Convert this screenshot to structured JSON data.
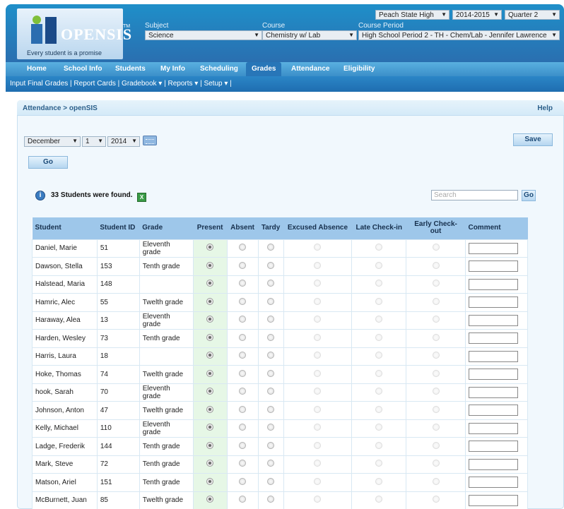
{
  "header": {
    "tagline": "Every student is a promise",
    "logo_text": "OPENSIS",
    "logo_tm": "TM",
    "school": "Peach State High",
    "year": "2014-2015",
    "quarter": "Quarter 2",
    "subject_label": "Subject",
    "subject_value": "Science",
    "course_label": "Course",
    "course_value": "Chemistry w/ Lab",
    "period_label": "Course Period",
    "period_value": "High School Period 2 - TH - Chem/Lab - Jennifer Lawrence"
  },
  "nav": {
    "items": [
      "Home",
      "School Info",
      "Students",
      "My Info",
      "Scheduling",
      "Grades",
      "Attendance",
      "Eligibility"
    ],
    "active": "Grades"
  },
  "subnav": {
    "text": "Input Final Grades  |  Report Cards  |  Gradebook ▾  |   Reports ▾  |  Setup ▾  |"
  },
  "panel": {
    "breadcrumb": "Attendance > openSIS",
    "help": "Help",
    "month": "December",
    "day": "1",
    "year": "2014",
    "go_label": "Go",
    "save_label": "Save",
    "found_text": "33 Students were found.",
    "search_placeholder": "Search",
    "search_go": "Go"
  },
  "table": {
    "headers": [
      "Student",
      "Student ID",
      "Grade",
      "Present",
      "Absent",
      "Tardy",
      "Excused Absence",
      "Late Check-in",
      "Early Check-out",
      "Comment"
    ],
    "rows": [
      {
        "name": "Daniel, Marie",
        "id": "51",
        "grade": "Eleventh grade"
      },
      {
        "name": "Dawson, Stella",
        "id": "153",
        "grade": "Tenth grade"
      },
      {
        "name": "Halstead, Maria",
        "id": "148",
        "grade": ""
      },
      {
        "name": "Hamric, Alec",
        "id": "55",
        "grade": "Twelth grade"
      },
      {
        "name": "Haraway, Alea",
        "id": "13",
        "grade": "Eleventh grade"
      },
      {
        "name": "Harden, Wesley",
        "id": "73",
        "grade": "Tenth grade"
      },
      {
        "name": "Harris, Laura",
        "id": "18",
        "grade": ""
      },
      {
        "name": "Hoke, Thomas",
        "id": "74",
        "grade": "Twelth grade"
      },
      {
        "name": "hook, Sarah",
        "id": "70",
        "grade": "Eleventh grade"
      },
      {
        "name": "Johnson, Anton",
        "id": "47",
        "grade": "Twelth grade"
      },
      {
        "name": "Kelly, Michael",
        "id": "110",
        "grade": "Eleventh grade"
      },
      {
        "name": "Ladge, Frederik",
        "id": "144",
        "grade": "Tenth grade"
      },
      {
        "name": "Mark, Steve",
        "id": "72",
        "grade": "Tenth grade"
      },
      {
        "name": "Matson, Ariel",
        "id": "151",
        "grade": "Tenth grade"
      },
      {
        "name": "McBurnett, Juan",
        "id": "85",
        "grade": "Twelth grade"
      }
    ]
  }
}
